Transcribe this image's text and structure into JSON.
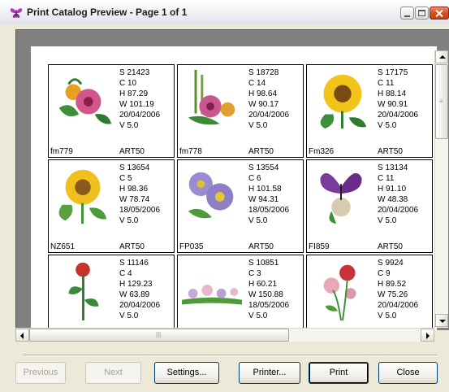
{
  "window": {
    "title": "Print Catalog Preview - Page 1 of 1"
  },
  "catalog": [
    {
      "code": "fm779",
      "stitches": "S  21423",
      "colors": "C  10",
      "height": "H  87.29",
      "width": "W 101.19",
      "date": "20/04/2006",
      "version": "V  5.0",
      "art": "ART50",
      "picture": "pink-flower-bouquet"
    },
    {
      "code": "fm778",
      "stitches": "S  18728",
      "colors": "C  14",
      "height": "H  98.64",
      "width": "W 90.17",
      "date": "20/04/2006",
      "version": "V  5.0",
      "art": "ART50",
      "picture": "flowers-with-bamboo"
    },
    {
      "code": "Fm326",
      "stitches": "S  17175",
      "colors": "C  11",
      "height": "H  88.14",
      "width": "W 90.91",
      "date": "20/04/2006",
      "version": "V  5.0",
      "art": "ART50",
      "picture": "sunflower"
    },
    {
      "code": "NZ651",
      "stitches": "S  13654",
      "colors": "C  5",
      "height": "H  98.36",
      "width": "W 78.74",
      "date": "18/05/2006",
      "version": "V  5.0",
      "art": "ART50",
      "picture": "sunflower-leaves"
    },
    {
      "code": "FP035",
      "stitches": "S  13554",
      "colors": "C  6",
      "height": "H  101.58",
      "width": "W 94.31",
      "date": "18/05/2006",
      "version": "V  5.0",
      "art": "ART50",
      "picture": "purple-daisies"
    },
    {
      "code": "FI859",
      "stitches": "S  13134",
      "colors": "C  11",
      "height": "H  91.10",
      "width": "W 48.38",
      "date": "20/04/2006",
      "version": "V  5.0",
      "art": "ART50",
      "picture": "butterfly-on-flower"
    },
    {
      "code": "",
      "stitches": "S  11146",
      "colors": "C  4",
      "height": "H  129.23",
      "width": "W 63.89",
      "date": "20/04/2006",
      "version": "V  5.0",
      "art": "",
      "picture": "red-rose"
    },
    {
      "code": "",
      "stitches": "S  10851",
      "colors": "C  3",
      "height": "H  60.21",
      "width": "W 150.88",
      "date": "18/05/2006",
      "version": "V  5.0",
      "art": "",
      "picture": "flower-border"
    },
    {
      "code": "",
      "stitches": "S  9924",
      "colors": "C  9",
      "height": "H  89.52",
      "width": "W 75.26",
      "date": "20/04/2006",
      "version": "V  5.0",
      "art": "",
      "picture": "wildflower-spray"
    }
  ],
  "buttons": {
    "previous": "Previous",
    "next": "Next",
    "settings": "Settings...",
    "printer": "Printer...",
    "print": "Print",
    "close": "Close"
  },
  "icons": {
    "app": "butterfly-icon",
    "minimize": "minimize-icon",
    "maximize": "maximize-icon",
    "close": "close-icon",
    "scroll_up": "arrow-up-icon",
    "scroll_down": "arrow-down-icon",
    "scroll_left": "arrow-left-icon",
    "scroll_right": "arrow-right-icon"
  },
  "colors": {
    "preview_background": "#808080",
    "page_background": "#ffffff",
    "dialog_background": "#ece9d8",
    "close_button": "#d34f23"
  }
}
